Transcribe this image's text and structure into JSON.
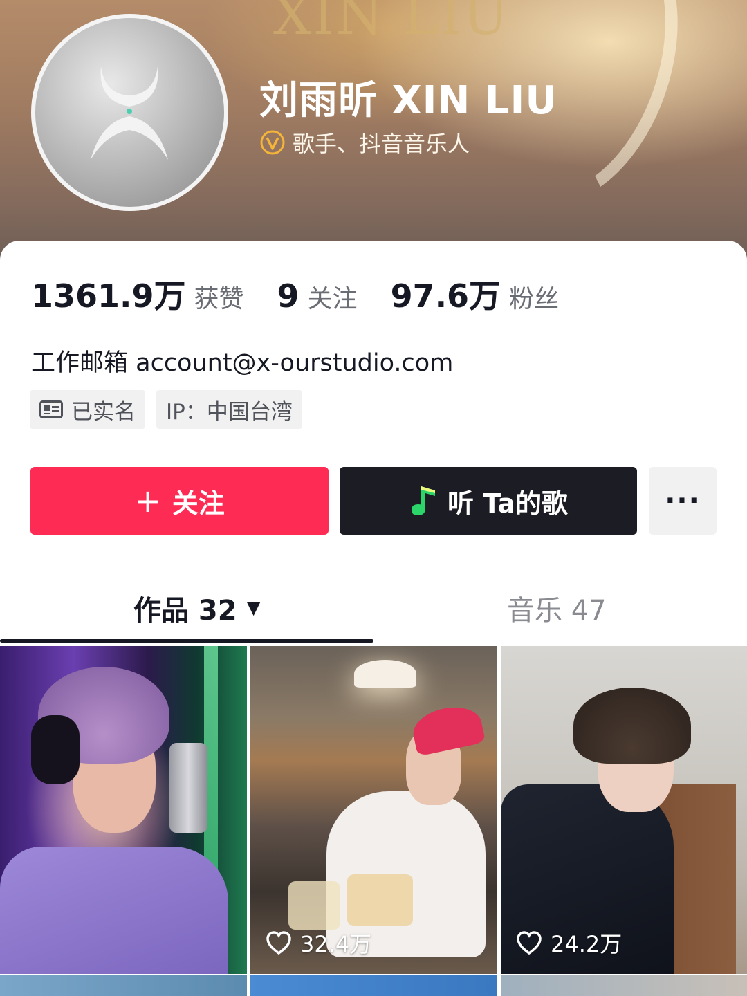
{
  "profile": {
    "banner_watermark": "XIN LIU",
    "name": "刘雨昕 XIN LIU",
    "verify_label": "歌手、抖音音乐人"
  },
  "stats": [
    {
      "value": "1361.9万",
      "label": "获赞"
    },
    {
      "value": "9",
      "label": "关注"
    },
    {
      "value": "97.6万",
      "label": "粉丝"
    }
  ],
  "email_line": "工作邮箱 account@x-ourstudio.com",
  "tags": {
    "verified": "已实名",
    "ip": "IP：中国台湾"
  },
  "actions": {
    "follow_plus": "+",
    "follow": "关注",
    "listen": "听 Ta的歌",
    "more": "···"
  },
  "tabs": {
    "works": "作品 32",
    "music": "音乐 47"
  },
  "videos": [
    {
      "likes": ""
    },
    {
      "likes": "32.4万"
    },
    {
      "likes": "24.2万"
    }
  ],
  "colors": {
    "follow_button": "#fe2c55",
    "listen_button": "#1c1c24",
    "verify_badge": "#f5b53a"
  }
}
